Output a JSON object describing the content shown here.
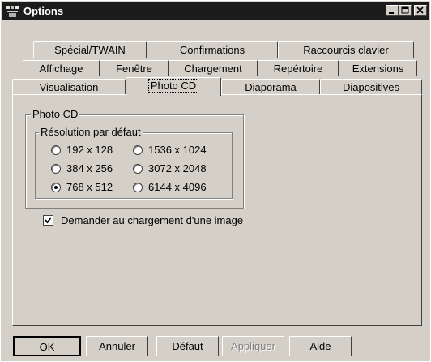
{
  "window": {
    "title": "Options"
  },
  "titlebar_buttons": [
    "minimize-button",
    "maximize-button",
    "close-button"
  ],
  "tabs": {
    "row1": [
      "Spécial/TWAIN",
      "Confirmations",
      "Raccourcis clavier"
    ],
    "row2": [
      "Affichage",
      "Fenêtre",
      "Chargement",
      "Repértoire",
      "Extensions"
    ],
    "row3": [
      "Visualisation",
      "Photo CD",
      "Diaporama",
      "Diapositives"
    ],
    "active": "Photo CD"
  },
  "photo_cd": {
    "group_title": "Photo CD",
    "resolution_title": "Résolution par défaut",
    "resolutions": [
      {
        "label": "192 x 128",
        "selected": false
      },
      {
        "label": "1536 x 1024",
        "selected": false
      },
      {
        "label": "384 x 256",
        "selected": false
      },
      {
        "label": "3072 x 2048",
        "selected": false
      },
      {
        "label": "768 x 512",
        "selected": true
      },
      {
        "label": "6144 x 4096",
        "selected": false
      }
    ],
    "ask_on_load": {
      "label": "Demander au chargement d'une image",
      "checked": true
    }
  },
  "buttons": {
    "ok": "OK",
    "cancel": "Annuler",
    "default": "Défaut",
    "apply": "Appliquer",
    "help": "Aide"
  }
}
